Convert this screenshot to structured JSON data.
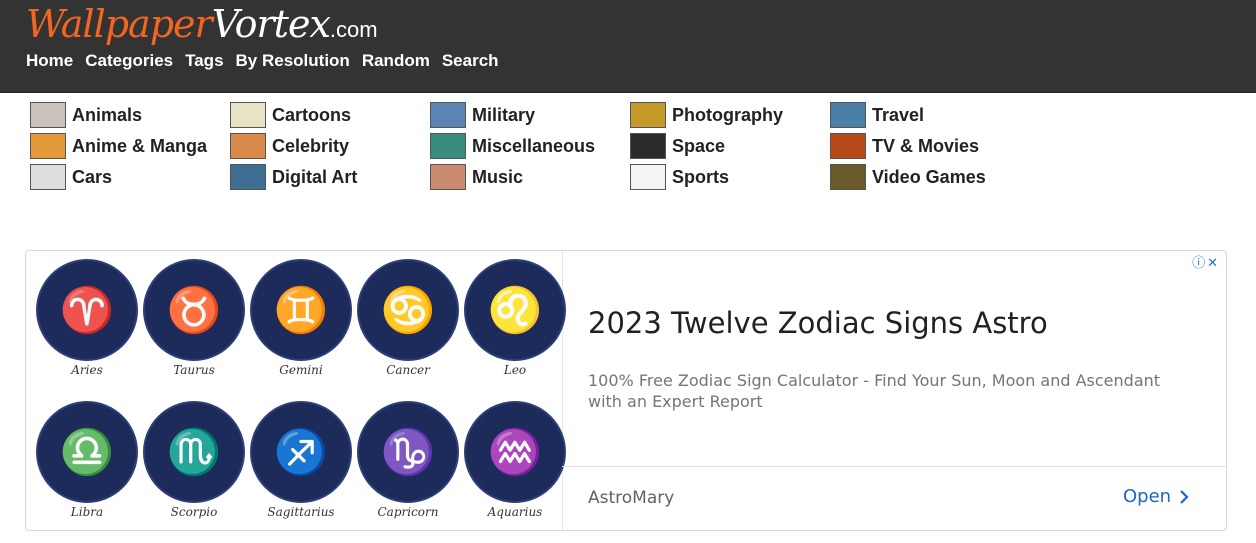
{
  "site": {
    "logo_part1": "Wallpaper",
    "logo_part2": "Vortex",
    "logo_part3": ".com"
  },
  "nav": [
    "Home",
    "Categories",
    "Tags",
    "By Resolution",
    "Random",
    "Search"
  ],
  "categories": [
    {
      "label": "Animals",
      "icon": "kitten-thumb-icon",
      "color": "#c9c2bb"
    },
    {
      "label": "Anime & Manga",
      "icon": "anime-thumb-icon",
      "color": "#e59a3a"
    },
    {
      "label": "Cars",
      "icon": "car-thumb-icon",
      "color": "#dedede"
    },
    {
      "label": "Cartoons",
      "icon": "mickey-thumb-icon",
      "color": "#e8e3c5"
    },
    {
      "label": "Celebrity",
      "icon": "celebrity-thumb-icon",
      "color": "#d88a4a"
    },
    {
      "label": "Digital Art",
      "icon": "digital-art-thumb-icon",
      "color": "#3f6e93"
    },
    {
      "label": "Military",
      "icon": "jet-thumb-icon",
      "color": "#5b84b5"
    },
    {
      "label": "Miscellaneous",
      "icon": "misc-thumb-icon",
      "color": "#3a8c80"
    },
    {
      "label": "Music",
      "icon": "music-thumb-icon",
      "color": "#c98a6e"
    },
    {
      "label": "Photography",
      "icon": "sunflower-thumb-icon",
      "color": "#c59a2a"
    },
    {
      "label": "Space",
      "icon": "moon-thumb-icon",
      "color": "#2a2a2a"
    },
    {
      "label": "Sports",
      "icon": "soccer-ball-thumb-icon",
      "color": "#f4f4f4"
    },
    {
      "label": "Travel",
      "icon": "statue-thumb-icon",
      "color": "#4a7fa8"
    },
    {
      "label": "TV & Movies",
      "icon": "tv-movies-thumb-icon",
      "color": "#b84a1a"
    },
    {
      "label": "Video Games",
      "icon": "video-games-thumb-icon",
      "color": "#6b5a2a"
    }
  ],
  "ad": {
    "image_signs": [
      {
        "name": "Aries",
        "glyph": "♈"
      },
      {
        "name": "Taurus",
        "glyph": "♉"
      },
      {
        "name": "Gemini",
        "glyph": "♊"
      },
      {
        "name": "Cancer",
        "glyph": "♋"
      },
      {
        "name": "Leo",
        "glyph": "♌"
      },
      {
        "name": "Libra",
        "glyph": "♎"
      },
      {
        "name": "Scorpio",
        "glyph": "♏"
      },
      {
        "name": "Sagittarius",
        "glyph": "♐"
      },
      {
        "name": "Capricorn",
        "glyph": "♑"
      },
      {
        "name": "Aquarius",
        "glyph": "♒"
      }
    ],
    "title": "2023 Twelve Zodiac Signs Astro",
    "description": "100% Free Zodiac Sign Calculator - Find Your Sun, Moon and Ascendant with an Expert Report",
    "advertiser": "AstroMary",
    "open_label": "Open"
  },
  "colors": {
    "header_bg": "#333333",
    "logo_accent": "#f26522",
    "link_blue": "#1a66c9"
  }
}
